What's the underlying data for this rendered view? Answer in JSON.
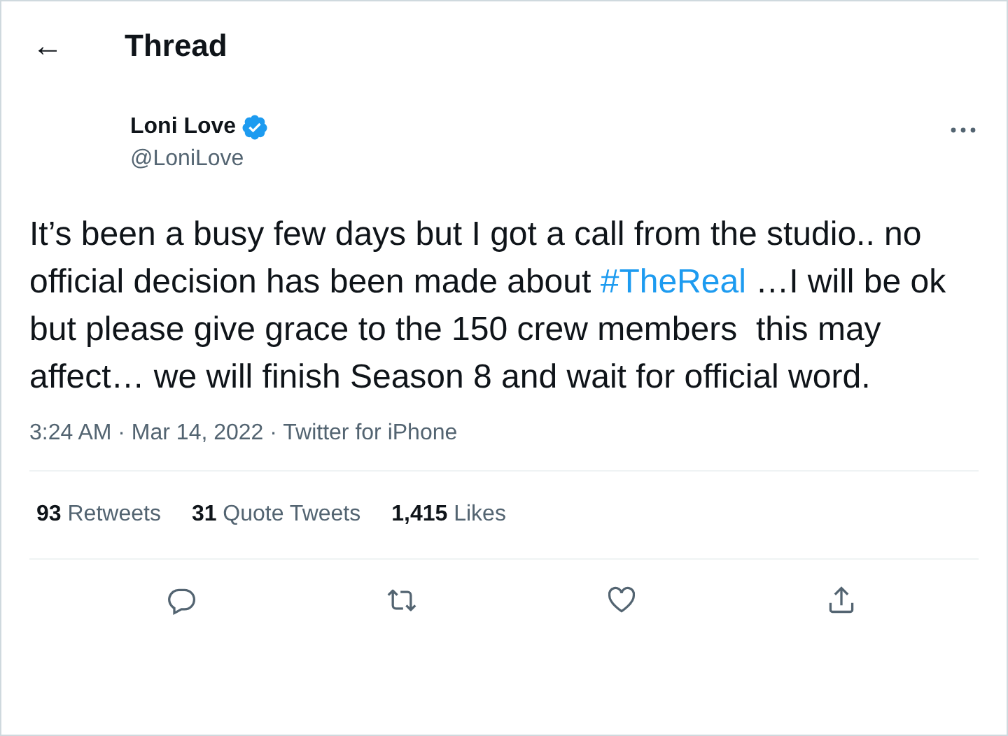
{
  "header": {
    "back_icon": "←",
    "title": "Thread"
  },
  "author": {
    "name": "Loni Love",
    "verified": true,
    "handle": "@LoniLove"
  },
  "tweet": {
    "text_before": "It’s been a busy few days but I got a call from the studio.. no official decision has been made about",
    "hashtag": "#TheReal",
    "text_after": "…I will be ok but please give grace to the 150 crew members  this may affect… we will finish Season 8 and wait for official word."
  },
  "meta": "3:24 AM · Mar 14, 2022 · Twitter for iPhone",
  "stats": [
    {
      "count": "93",
      "label": "Retweets"
    },
    {
      "count": "31",
      "label": "Quote Tweets"
    },
    {
      "count": "1,415",
      "label": "Likes"
    }
  ],
  "actions": [
    {
      "kind": "reply"
    },
    {
      "kind": "retweet"
    },
    {
      "kind": "like"
    },
    {
      "kind": "share"
    }
  ]
}
